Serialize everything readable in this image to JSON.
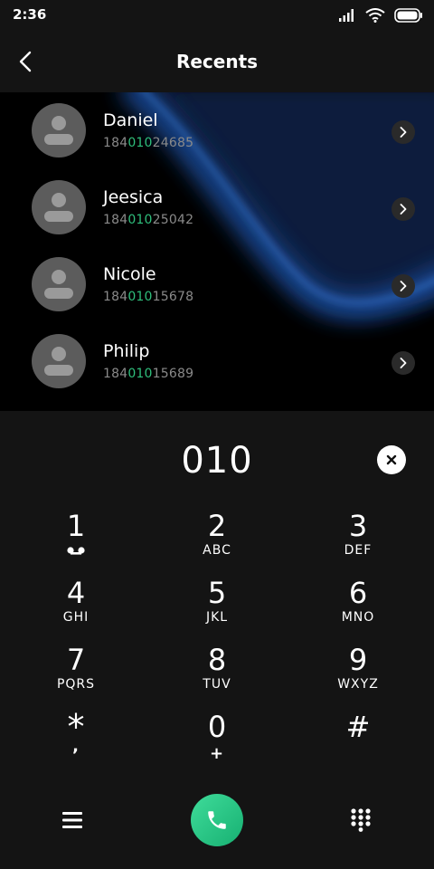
{
  "status_bar": {
    "time": "2:36"
  },
  "header": {
    "title": "Recents"
  },
  "contacts": [
    {
      "name": "Daniel",
      "number_prefix": "184",
      "number_match": "010",
      "number_suffix": "24685"
    },
    {
      "name": "Jeesica",
      "number_prefix": "184",
      "number_match": "010",
      "number_suffix": "25042"
    },
    {
      "name": "Nicole",
      "number_prefix": "184",
      "number_match": "010",
      "number_suffix": "15678"
    },
    {
      "name": "Philip",
      "number_prefix": "184",
      "number_match": "010",
      "number_suffix": "15689"
    }
  ],
  "dialpad": {
    "display": "010",
    "keys": [
      {
        "digit": "1",
        "letters": ""
      },
      {
        "digit": "2",
        "letters": "ABC"
      },
      {
        "digit": "3",
        "letters": "DEF"
      },
      {
        "digit": "4",
        "letters": "GHI"
      },
      {
        "digit": "5",
        "letters": "JKL"
      },
      {
        "digit": "6",
        "letters": "MNO"
      },
      {
        "digit": "7",
        "letters": "PQRS"
      },
      {
        "digit": "8",
        "letters": "TUV"
      },
      {
        "digit": "9",
        "letters": "WXYZ"
      },
      {
        "digit": "*",
        "letters": ","
      },
      {
        "digit": "0",
        "letters": "+"
      },
      {
        "digit": "#",
        "letters": ""
      }
    ]
  },
  "colors": {
    "background": "#141414",
    "match_highlight": "#2fbf7c",
    "call_button": "#1fc07e",
    "wave_accent": "#1a4fa0"
  },
  "icons": {
    "back": "back-arrow-icon",
    "detail": "chevron-right-icon",
    "clear": "close-icon",
    "voicemail": "voicemail-icon",
    "menu": "menu-icon",
    "call": "phone-icon",
    "dialpad_toggle": "dialpad-icon"
  }
}
